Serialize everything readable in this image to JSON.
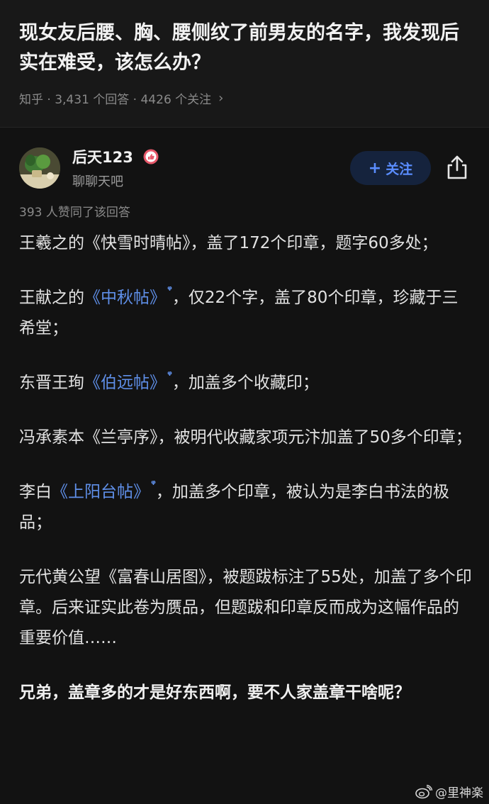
{
  "question": {
    "title": "现女友后腰、胸、腰侧纹了前男友的名字，我发现后实在难受，该怎么办？",
    "meta": "知乎 · 3,431 个回答 · 4426 个关注",
    "arrow": "›"
  },
  "author": {
    "name": "后天123",
    "bio": "聊聊天吧",
    "badge_icon": "like-badge-icon",
    "follow_plus": "+",
    "follow_label": "关注",
    "share_icon": "share-icon"
  },
  "answer": {
    "votes": "393 人赞同了该回答",
    "paragraphs": [
      {
        "text": "王羲之的《快雪时晴帖》，盖了172个印章，题字60多处；"
      },
      {
        "pre": "王献之的",
        "link": "《中秋帖》",
        "post": "，仅22个字，盖了80个印章，珍藏于三希堂；"
      },
      {
        "pre": "东晋王珣",
        "link": "《伯远帖》",
        "post": "，加盖多个收藏印；"
      },
      {
        "text": "冯承素本《兰亭序》，被明代收藏家项元汴加盖了50多个印章；"
      },
      {
        "pre": "李白",
        "link": "《上阳台帖》",
        "post": "，加盖多个印章，被认为是李白书法的极品；"
      },
      {
        "text": "元代黄公望《富春山居图》，被题跋标注了55处，加盖了多个印章。后来证实此卷为赝品，但题跋和印章反而成为这幅作品的重要价值……"
      },
      {
        "text": "兄弟，盖章多的才是好东西啊，要不人家盖章干啥呢？"
      }
    ],
    "search_glyph": "ᵠ"
  },
  "watermark": {
    "icon": "weibo-icon",
    "text": "@里神楽"
  },
  "colors": {
    "background": "#121212",
    "link": "#5f8fe8",
    "follow_bg": "#15233d",
    "follow_text": "#5a8dff"
  }
}
